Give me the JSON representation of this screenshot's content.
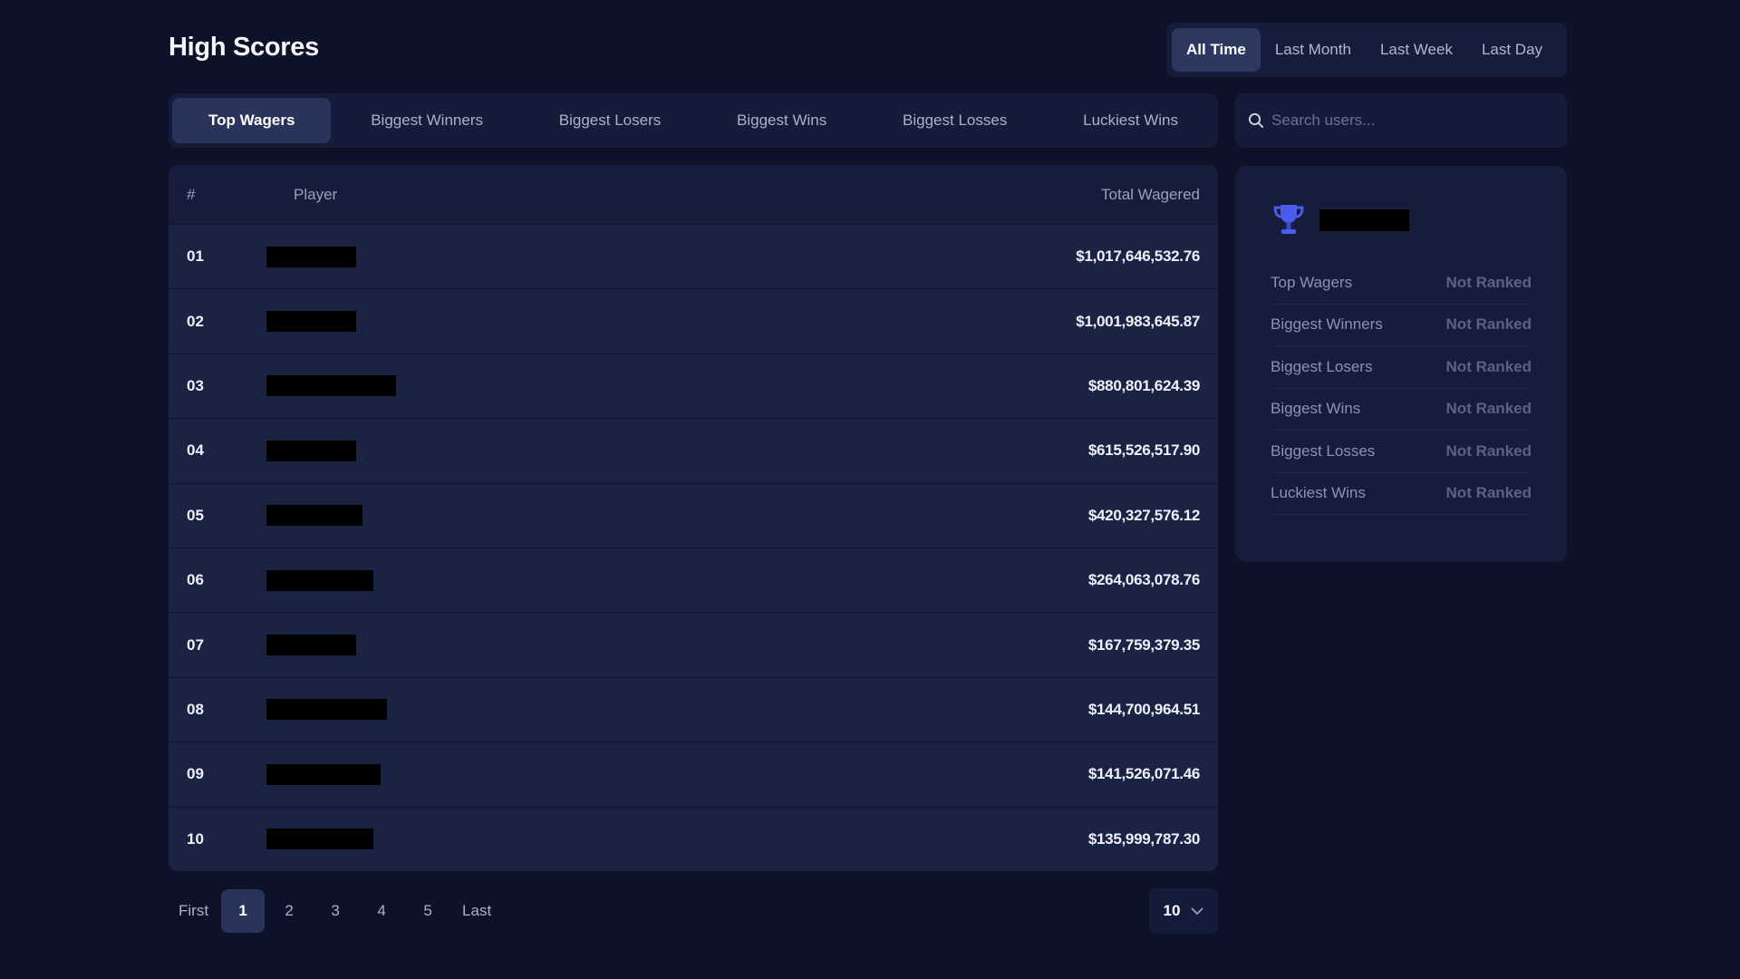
{
  "page": {
    "title": "High Scores"
  },
  "period": {
    "options": [
      "All Time",
      "Last Month",
      "Last Week",
      "Last Day"
    ],
    "selected": "All Time"
  },
  "tabs": {
    "items": [
      "Top Wagers",
      "Biggest Winners",
      "Biggest Losers",
      "Biggest Wins",
      "Biggest Losses",
      "Luckiest Wins"
    ],
    "selected": "Top Wagers"
  },
  "search": {
    "placeholder": "Search users...",
    "value": ""
  },
  "table": {
    "headers": {
      "rank": "#",
      "player": "Player",
      "total": "Total Wagered"
    },
    "rows": [
      {
        "rank": "01",
        "amount": "$1,017,646,532.76"
      },
      {
        "rank": "02",
        "amount": "$1,001,983,645.87"
      },
      {
        "rank": "03",
        "amount": "$880,801,624.39"
      },
      {
        "rank": "04",
        "amount": "$615,526,517.90"
      },
      {
        "rank": "05",
        "amount": "$420,327,576.12"
      },
      {
        "rank": "06",
        "amount": "$264,063,078.76"
      },
      {
        "rank": "07",
        "amount": "$167,759,379.35"
      },
      {
        "rank": "08",
        "amount": "$144,700,964.51"
      },
      {
        "rank": "09",
        "amount": "$141,526,071.46"
      },
      {
        "rank": "10",
        "amount": "$135,999,787.30"
      }
    ]
  },
  "pagination": {
    "first": "First",
    "last": "Last",
    "pages": [
      "1",
      "2",
      "3",
      "4",
      "5"
    ],
    "current": "1"
  },
  "per_page": {
    "value": "10"
  },
  "rank_card": {
    "icon": "trophy-icon",
    "stats": [
      {
        "label": "Top Wagers",
        "value": "Not Ranked"
      },
      {
        "label": "Biggest Winners",
        "value": "Not Ranked"
      },
      {
        "label": "Biggest Losers",
        "value": "Not Ranked"
      },
      {
        "label": "Biggest Wins",
        "value": "Not Ranked"
      },
      {
        "label": "Biggest Losses",
        "value": "Not Ranked"
      },
      {
        "label": "Luckiest Wins",
        "value": "Not Ranked"
      }
    ]
  },
  "colors": {
    "background": "#0d1229",
    "panel": "#161d3a",
    "row": "#1b2344",
    "active": "#2a345b",
    "accent": "#4a5bf0"
  }
}
